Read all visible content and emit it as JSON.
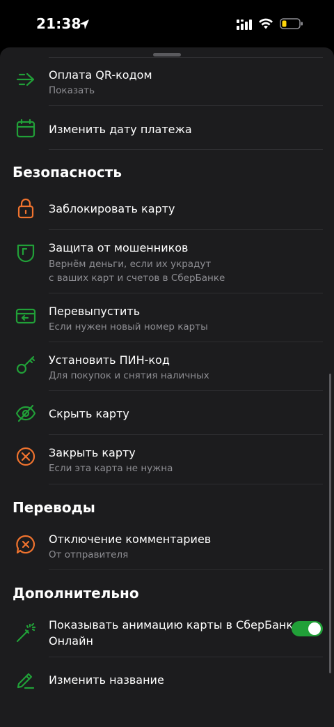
{
  "status_bar": {
    "time": "21:38"
  },
  "colors": {
    "green": "#21a038",
    "orange": "#f0732e",
    "subtitle": "#8e8e93"
  },
  "rows": {
    "qr_payment": {
      "title": "Оплата QR-кодом",
      "subtitle": "Показать",
      "icon": "qr-arrow-icon"
    },
    "change_date": {
      "title": "Изменить дату платежа",
      "icon": "calendar-icon"
    },
    "block_card": {
      "title": "Заблокировать карту",
      "icon": "lock-icon"
    },
    "fraud_protection": {
      "title": "Защита от мошенников",
      "subtitle_line1": "Вернём деньги, если их украдут",
      "subtitle_line2": "с ваших карт и счетов в СберБанке",
      "icon": "shield-icon"
    },
    "reissue": {
      "title": "Перевыпустить",
      "subtitle": "Если нужен новый номер карты",
      "icon": "card-reissue-icon"
    },
    "set_pin": {
      "title": "Установить ПИН-код",
      "subtitle": "Для покупок и снятия наличных",
      "icon": "key-icon"
    },
    "hide_card": {
      "title": "Скрыть карту",
      "icon": "eye-off-icon"
    },
    "close_card": {
      "title": "Закрыть карту",
      "subtitle": "Если эта карта не нужна",
      "icon": "close-circle-icon"
    },
    "disable_comments": {
      "title": "Отключение комментариев",
      "subtitle": "От отправителя",
      "icon": "comment-off-icon"
    },
    "card_animation": {
      "title_line1": "Показывать анимацию карты в СберБанк",
      "title_line2": "Онлайн",
      "icon": "magic-wand-icon",
      "toggle_on": true
    },
    "rename": {
      "title": "Изменить название",
      "icon": "pencil-icon"
    }
  },
  "sections": {
    "security": "Безопасность",
    "transfers": "Переводы",
    "additional": "Дополнительно"
  }
}
